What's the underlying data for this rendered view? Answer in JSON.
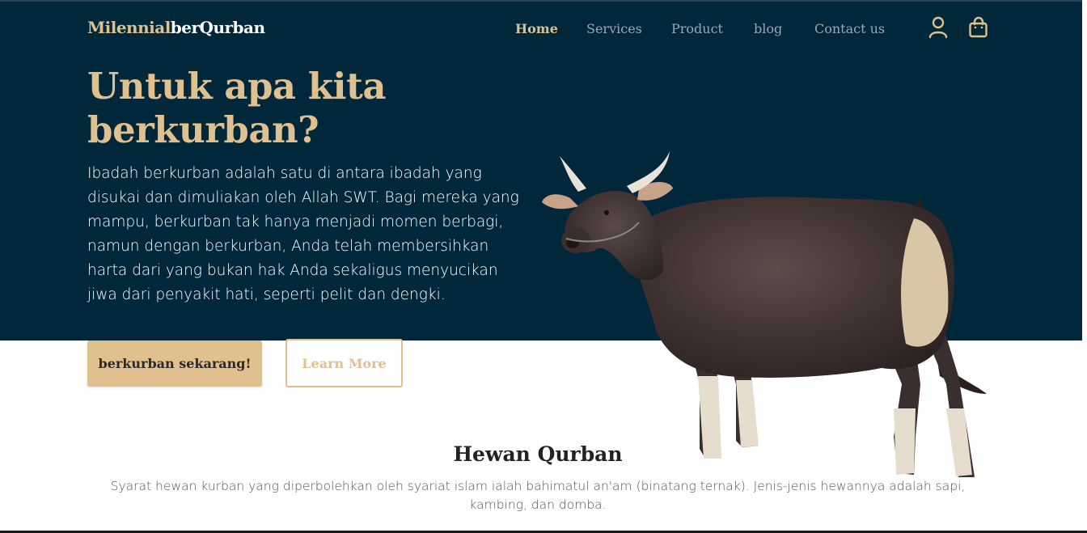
{
  "header": {
    "brand_part1": "Milennial",
    "brand_part2": "berQurban",
    "nav": [
      {
        "label": "Home",
        "active": true
      },
      {
        "label": "Services",
        "active": false
      },
      {
        "label": "Product",
        "active": false
      },
      {
        "label": "blog",
        "active": false
      },
      {
        "label": "Contact us",
        "active": false
      }
    ],
    "icons": [
      "user-icon",
      "shopping-bag-icon"
    ]
  },
  "hero": {
    "title": "Untuk apa kita berkurban?",
    "text": "Ibadah berkurban adalah satu di antara ibadah yang disukai dan dimuliakan oleh Allah SWT. Bagi mereka yang mampu, berkurban tak hanya menjadi momen berbagi, namun dengan berkurban, Anda telah membersihkan harta dari yang bukan hak Anda sekaligus menyucikan jiwa dari penyakit hati, seperti pelit dan dengki.",
    "primary_button": "berkurban sekarang!",
    "secondary_button": "Learn More",
    "image": "cow-image"
  },
  "section": {
    "title": "Hewan Qurban",
    "text": "Syarat hewan kurban yang diperbolehkan oleh syariat islam ialah bahimatul an'am (binatang ternak). Jenis-jenis hewannya adalah sapi, kambing, dan domba."
  },
  "colors": {
    "navy": "#00283a",
    "gold": "#dfc08e",
    "white": "#ffffff"
  }
}
